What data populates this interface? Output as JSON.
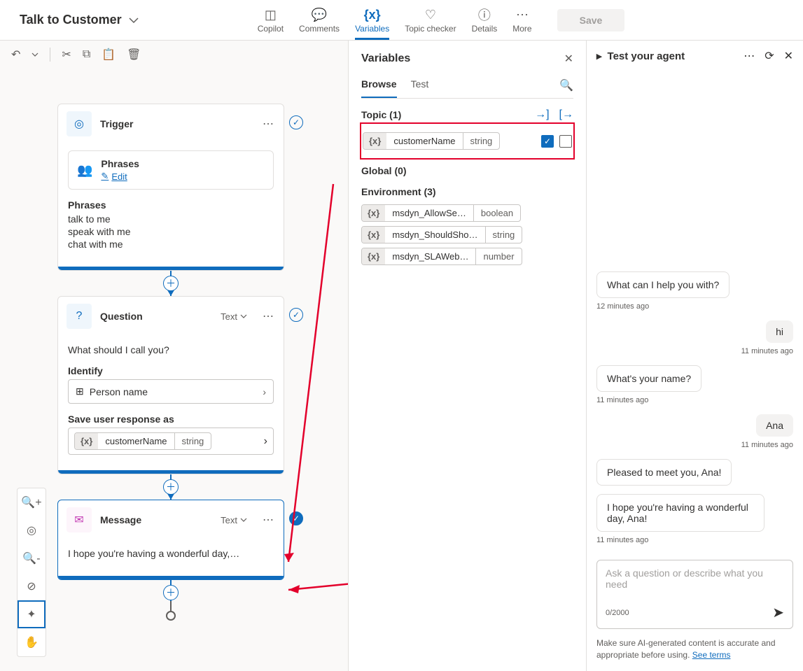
{
  "header": {
    "title": "Talk to Customer",
    "tabs": {
      "copilot": "Copilot",
      "comments": "Comments",
      "variables": "Variables",
      "topic_checker": "Topic checker",
      "details": "Details",
      "more": "More"
    },
    "save": "Save"
  },
  "canvas": {
    "trigger": {
      "title": "Trigger",
      "phrases_label": "Phrases",
      "edit": "Edit",
      "phrases_title": "Phrases",
      "phrases": [
        "talk to me",
        "speak with me",
        "chat with me"
      ]
    },
    "question": {
      "title": "Question",
      "type": "Text",
      "prompt": "What should I call you?",
      "identify_label": "Identify",
      "identify_value": "Person name",
      "save_as_label": "Save user response as",
      "var_name": "customerName",
      "var_type": "string"
    },
    "message": {
      "title": "Message",
      "type": "Text",
      "text": "I hope you're having a wonderful day,…"
    }
  },
  "variables_panel": {
    "title": "Variables",
    "tabs": {
      "browse": "Browse",
      "test": "Test"
    },
    "sections": {
      "topic": {
        "label": "Topic (1)"
      },
      "global": {
        "label": "Global (0)"
      },
      "env": {
        "label": "Environment (3)"
      }
    },
    "topic_var": {
      "name": "customerName",
      "type": "string"
    },
    "env_vars": [
      {
        "name": "msdyn_AllowSe…",
        "type": "boolean"
      },
      {
        "name": "msdyn_ShouldSho…",
        "type": "string"
      },
      {
        "name": "msdyn_SLAWeb…",
        "type": "number"
      }
    ]
  },
  "test_panel": {
    "title": "Test your agent",
    "icon_dots": "more-icon",
    "chat": [
      {
        "role": "bot",
        "text": "What can I help you with?",
        "ts": "12 minutes ago"
      },
      {
        "role": "user",
        "text": "hi",
        "ts": "11 minutes ago"
      },
      {
        "role": "bot",
        "text": "What's your name?",
        "ts": "11 minutes ago"
      },
      {
        "role": "user",
        "text": "Ana",
        "ts": "11 minutes ago"
      },
      {
        "role": "bot",
        "text": "Pleased to meet you, Ana!",
        "ts": ""
      },
      {
        "role": "bot",
        "text": "I hope you're having a wonderful day, Ana!",
        "ts": "11 minutes ago"
      }
    ],
    "input_placeholder": "Ask a question or describe what you need",
    "count": "0/2000",
    "disclaimer_pre": "Make sure AI-generated content is accurate and appropriate before using. ",
    "disclaimer_link": "See terms"
  },
  "var_glyph": "{x}"
}
